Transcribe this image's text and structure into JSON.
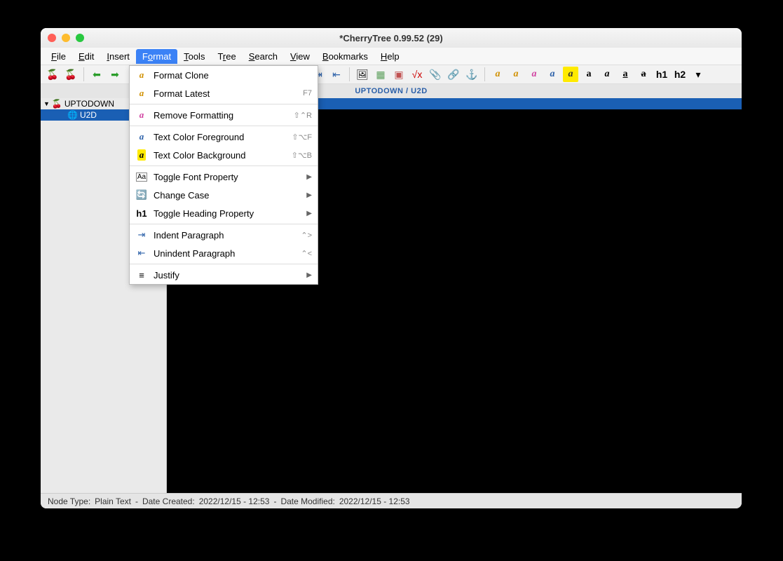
{
  "window": {
    "title": "*CherryTree 0.99.52 (29)"
  },
  "menubar": [
    "File",
    "Edit",
    "Insert",
    "Format",
    "Tools",
    "Tree",
    "Search",
    "View",
    "Bookmarks",
    "Help"
  ],
  "menubar_active": "Format",
  "breadcrumb": "UPTODOWN / U2D",
  "tree": {
    "root": {
      "label": "UPTODOWN"
    },
    "child": {
      "label": "U2D"
    }
  },
  "dropdown": [
    {
      "icon": "clone",
      "label": "Format Clone",
      "shortcut": "",
      "sub": false
    },
    {
      "icon": "latest",
      "label": "Format Latest",
      "shortcut": "F7",
      "sub": false
    },
    {
      "sep": true
    },
    {
      "icon": "remove",
      "label": "Remove Formatting",
      "shortcut": "⇧⌃R",
      "sub": false
    },
    {
      "sep": true
    },
    {
      "icon": "fg",
      "label": "Text Color Foreground",
      "shortcut": "⇧⌥F",
      "sub": false
    },
    {
      "icon": "bg",
      "label": "Text Color Background",
      "shortcut": "⇧⌥B",
      "sub": false
    },
    {
      "sep": true
    },
    {
      "icon": "font",
      "label": "Toggle Font Property",
      "shortcut": "",
      "sub": true
    },
    {
      "icon": "case",
      "label": "Change Case",
      "shortcut": "",
      "sub": true
    },
    {
      "icon": "h1",
      "label": "Toggle Heading Property",
      "shortcut": "",
      "sub": true
    },
    {
      "sep": true
    },
    {
      "icon": "indent",
      "label": "Indent Paragraph",
      "shortcut": "⌃>",
      "sub": false
    },
    {
      "icon": "unindent",
      "label": "Unindent Paragraph",
      "shortcut": "⌃<",
      "sub": false
    },
    {
      "sep": true
    },
    {
      "icon": "justify",
      "label": "Justify",
      "shortcut": "",
      "sub": true
    }
  ],
  "statusbar": {
    "node_type_label": "Node Type:",
    "node_type": "Plain Text",
    "created_label": "Date Created:",
    "created": "2022/12/15 - 12:53",
    "modified_label": "Date Modified:",
    "modified": "2022/12/15 - 12:53",
    "sep": "  -  "
  },
  "toolbar_labels": {
    "h1": "h1",
    "h2": "h2"
  }
}
